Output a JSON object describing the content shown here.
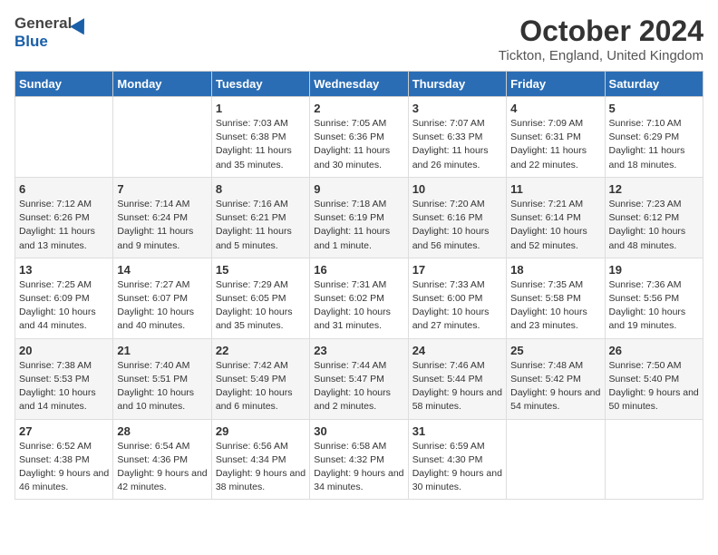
{
  "header": {
    "logo_general": "General",
    "logo_blue": "Blue",
    "month": "October 2024",
    "location": "Tickton, England, United Kingdom"
  },
  "days_of_week": [
    "Sunday",
    "Monday",
    "Tuesday",
    "Wednesday",
    "Thursday",
    "Friday",
    "Saturday"
  ],
  "weeks": [
    [
      {
        "day": "",
        "content": ""
      },
      {
        "day": "",
        "content": ""
      },
      {
        "day": "1",
        "content": "Sunrise: 7:03 AM\nSunset: 6:38 PM\nDaylight: 11 hours and 35 minutes."
      },
      {
        "day": "2",
        "content": "Sunrise: 7:05 AM\nSunset: 6:36 PM\nDaylight: 11 hours and 30 minutes."
      },
      {
        "day": "3",
        "content": "Sunrise: 7:07 AM\nSunset: 6:33 PM\nDaylight: 11 hours and 26 minutes."
      },
      {
        "day": "4",
        "content": "Sunrise: 7:09 AM\nSunset: 6:31 PM\nDaylight: 11 hours and 22 minutes."
      },
      {
        "day": "5",
        "content": "Sunrise: 7:10 AM\nSunset: 6:29 PM\nDaylight: 11 hours and 18 minutes."
      }
    ],
    [
      {
        "day": "6",
        "content": "Sunrise: 7:12 AM\nSunset: 6:26 PM\nDaylight: 11 hours and 13 minutes."
      },
      {
        "day": "7",
        "content": "Sunrise: 7:14 AM\nSunset: 6:24 PM\nDaylight: 11 hours and 9 minutes."
      },
      {
        "day": "8",
        "content": "Sunrise: 7:16 AM\nSunset: 6:21 PM\nDaylight: 11 hours and 5 minutes."
      },
      {
        "day": "9",
        "content": "Sunrise: 7:18 AM\nSunset: 6:19 PM\nDaylight: 11 hours and 1 minute."
      },
      {
        "day": "10",
        "content": "Sunrise: 7:20 AM\nSunset: 6:16 PM\nDaylight: 10 hours and 56 minutes."
      },
      {
        "day": "11",
        "content": "Sunrise: 7:21 AM\nSunset: 6:14 PM\nDaylight: 10 hours and 52 minutes."
      },
      {
        "day": "12",
        "content": "Sunrise: 7:23 AM\nSunset: 6:12 PM\nDaylight: 10 hours and 48 minutes."
      }
    ],
    [
      {
        "day": "13",
        "content": "Sunrise: 7:25 AM\nSunset: 6:09 PM\nDaylight: 10 hours and 44 minutes."
      },
      {
        "day": "14",
        "content": "Sunrise: 7:27 AM\nSunset: 6:07 PM\nDaylight: 10 hours and 40 minutes."
      },
      {
        "day": "15",
        "content": "Sunrise: 7:29 AM\nSunset: 6:05 PM\nDaylight: 10 hours and 35 minutes."
      },
      {
        "day": "16",
        "content": "Sunrise: 7:31 AM\nSunset: 6:02 PM\nDaylight: 10 hours and 31 minutes."
      },
      {
        "day": "17",
        "content": "Sunrise: 7:33 AM\nSunset: 6:00 PM\nDaylight: 10 hours and 27 minutes."
      },
      {
        "day": "18",
        "content": "Sunrise: 7:35 AM\nSunset: 5:58 PM\nDaylight: 10 hours and 23 minutes."
      },
      {
        "day": "19",
        "content": "Sunrise: 7:36 AM\nSunset: 5:56 PM\nDaylight: 10 hours and 19 minutes."
      }
    ],
    [
      {
        "day": "20",
        "content": "Sunrise: 7:38 AM\nSunset: 5:53 PM\nDaylight: 10 hours and 14 minutes."
      },
      {
        "day": "21",
        "content": "Sunrise: 7:40 AM\nSunset: 5:51 PM\nDaylight: 10 hours and 10 minutes."
      },
      {
        "day": "22",
        "content": "Sunrise: 7:42 AM\nSunset: 5:49 PM\nDaylight: 10 hours and 6 minutes."
      },
      {
        "day": "23",
        "content": "Sunrise: 7:44 AM\nSunset: 5:47 PM\nDaylight: 10 hours and 2 minutes."
      },
      {
        "day": "24",
        "content": "Sunrise: 7:46 AM\nSunset: 5:44 PM\nDaylight: 9 hours and 58 minutes."
      },
      {
        "day": "25",
        "content": "Sunrise: 7:48 AM\nSunset: 5:42 PM\nDaylight: 9 hours and 54 minutes."
      },
      {
        "day": "26",
        "content": "Sunrise: 7:50 AM\nSunset: 5:40 PM\nDaylight: 9 hours and 50 minutes."
      }
    ],
    [
      {
        "day": "27",
        "content": "Sunrise: 6:52 AM\nSunset: 4:38 PM\nDaylight: 9 hours and 46 minutes."
      },
      {
        "day": "28",
        "content": "Sunrise: 6:54 AM\nSunset: 4:36 PM\nDaylight: 9 hours and 42 minutes."
      },
      {
        "day": "29",
        "content": "Sunrise: 6:56 AM\nSunset: 4:34 PM\nDaylight: 9 hours and 38 minutes."
      },
      {
        "day": "30",
        "content": "Sunrise: 6:58 AM\nSunset: 4:32 PM\nDaylight: 9 hours and 34 minutes."
      },
      {
        "day": "31",
        "content": "Sunrise: 6:59 AM\nSunset: 4:30 PM\nDaylight: 9 hours and 30 minutes."
      },
      {
        "day": "",
        "content": ""
      },
      {
        "day": "",
        "content": ""
      }
    ]
  ]
}
